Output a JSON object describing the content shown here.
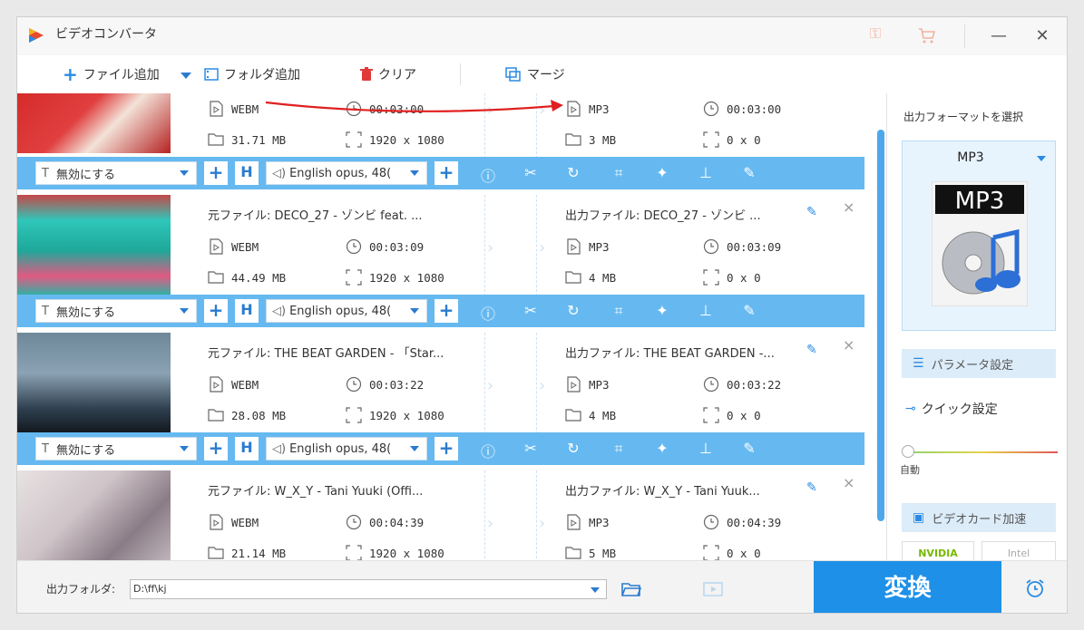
{
  "window": {
    "title": "ビデオコンバータ"
  },
  "toolbar": {
    "add_file": "ファイル追加",
    "add_folder": "フォルダ追加",
    "clear": "クリア",
    "merge": "マージ"
  },
  "items": [
    {
      "src_name": "",
      "src_format": "WEBM",
      "src_duration": "00:03:00",
      "src_size": "31.71 MB",
      "src_res": "1920 x 1080",
      "out_name": "",
      "out_format": "MP3",
      "out_duration": "00:03:00",
      "out_size": "3 MB",
      "out_res": "0 x 0"
    },
    {
      "src_name": "元ファイル: DECO_27 - ゾンビ feat. ...",
      "src_format": "WEBM",
      "src_duration": "00:03:09",
      "src_size": "44.49 MB",
      "src_res": "1920 x 1080",
      "out_name": "出力ファイル: DECO_27 - ゾンビ ...",
      "out_format": "MP3",
      "out_duration": "00:03:09",
      "out_size": "4 MB",
      "out_res": "0 x 0"
    },
    {
      "src_name": "元ファイル: THE BEAT GARDEN - 「Star...",
      "src_format": "WEBM",
      "src_duration": "00:03:22",
      "src_size": "28.08 MB",
      "src_res": "1920 x 1080",
      "out_name": "出力ファイル: THE BEAT GARDEN -...",
      "out_format": "MP3",
      "out_duration": "00:03:22",
      "out_size": "4 MB",
      "out_res": "0 x 0"
    },
    {
      "src_name": "元ファイル: W_X_Y - Tani Yuuki (Offi...",
      "src_format": "WEBM",
      "src_duration": "00:04:39",
      "src_size": "21.14 MB",
      "src_res": "1920 x 1080",
      "out_name": "出力ファイル: W_X_Y - Tani Yuuk...",
      "out_format": "MP3",
      "out_duration": "00:04:39",
      "out_size": "5 MB",
      "out_res": "0 x 0"
    }
  ],
  "controls": {
    "subtitle": "無効にする",
    "audio": "English opus, 48("
  },
  "side": {
    "title": "出力フォーマットを選択",
    "format": "MP3",
    "format_icon_text": "MP3",
    "param_btn": "パラメータ設定",
    "quick": "クイック設定",
    "auto": "自動",
    "gpu_btn": "ビデオカード加速",
    "nvidia": "NVIDIA",
    "intel": "Intel"
  },
  "bottom": {
    "out_label": "出力フォルダ:",
    "out_path": "D:\\ff\\kj",
    "convert": "変換"
  },
  "colors": {
    "accent": "#1e90e8",
    "bar": "#66b9f0",
    "arrow": "#e02020"
  }
}
